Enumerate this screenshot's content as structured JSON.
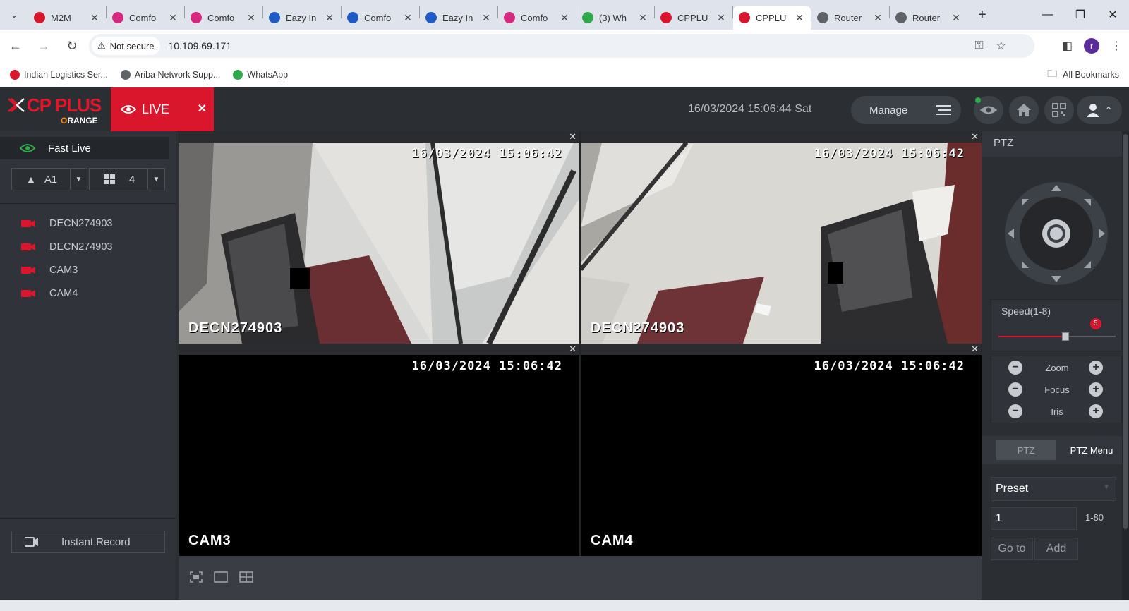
{
  "browser": {
    "tabs": [
      {
        "title": "M2M",
        "color": "#d9162b",
        "active": false
      },
      {
        "title": "Comfo",
        "color": "#d6287f",
        "active": false
      },
      {
        "title": "Comfo",
        "color": "#d6287f",
        "active": false
      },
      {
        "title": "Eazy In",
        "color": "#1e5bc6",
        "active": false
      },
      {
        "title": "Comfo",
        "color": "#1e5bc6",
        "active": false
      },
      {
        "title": "Eazy In",
        "color": "#1e5bc6",
        "active": false
      },
      {
        "title": "Comfo",
        "color": "#d6287f",
        "active": false
      },
      {
        "title": "(3) Wh",
        "color": "#2ea84a",
        "active": false
      },
      {
        "title": "CPPLU",
        "color": "#d9162b",
        "active": false
      },
      {
        "title": "CPPLU",
        "color": "#d9162b",
        "active": true
      },
      {
        "title": "Router",
        "color": "#5f6368",
        "active": false
      },
      {
        "title": "Router",
        "color": "#5f6368",
        "active": false
      }
    ],
    "security_label": "Not secure",
    "url": "10.109.69.171",
    "profile_initial": "r",
    "bookmarks": [
      {
        "label": "Indian Logistics Ser...",
        "color": "#d9162b"
      },
      {
        "label": "Ariba Network Supp...",
        "color": "#5f6368"
      },
      {
        "label": "WhatsApp",
        "color": "#2ea84a"
      }
    ],
    "all_bookmarks": "All Bookmarks"
  },
  "app": {
    "logo_main": "CP PLUS",
    "logo_sub": "RANGE",
    "logo_sub_first": "O",
    "live_tab_label": "LIVE",
    "datetime": "16/03/2024 15:06:44 Sat",
    "manage_label": "Manage"
  },
  "left_panel": {
    "fast_live": "Fast Live",
    "channel_select": "A1",
    "layout_select": "4",
    "devices": [
      "DECN274903",
      "DECN274903",
      "CAM3",
      "CAM4"
    ],
    "instant_record": "Instant Record"
  },
  "cameras": [
    {
      "name": "DECN274903",
      "timestamp": "16/03/2024 15:06:42",
      "has_video": true
    },
    {
      "name": "DECN274903",
      "timestamp": "16/03/2024 15:06:42",
      "has_video": true
    },
    {
      "name": "CAM3",
      "timestamp": "16/03/2024 15:06:42",
      "has_video": false
    },
    {
      "name": "CAM4",
      "timestamp": "16/03/2024 15:06:42",
      "has_video": false
    }
  ],
  "ptz": {
    "title": "PTZ",
    "speed_label": "Speed(1-8)",
    "speed_value": "5",
    "speed_fraction": 0.57,
    "zoom_label": "Zoom",
    "focus_label": "Focus",
    "iris_label": "Iris",
    "tab_ptz": "PTZ",
    "tab_menu": "PTZ Menu",
    "preset_label": "Preset",
    "preset_number": "1",
    "preset_range": "1-80",
    "goto_label": "Go to",
    "add_label": "Add"
  },
  "colors": {
    "accent": "#d9162b",
    "selected_border": "#2ea84a"
  }
}
